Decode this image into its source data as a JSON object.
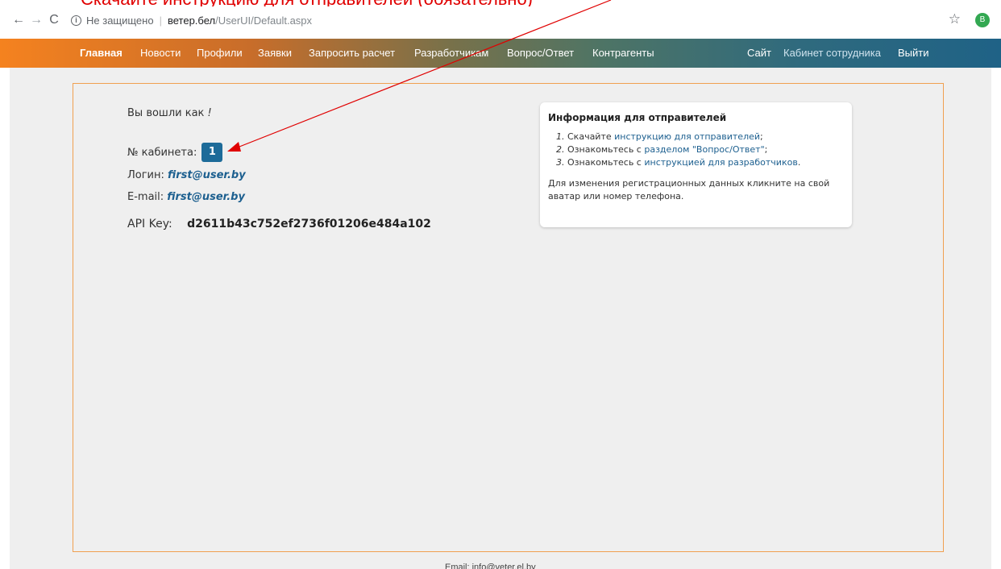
{
  "annotation": {
    "top_text": "Скачайте инструкцию для отправителей (обязательно)"
  },
  "browser": {
    "back_icon": "←",
    "forward_icon": "→",
    "reload_icon": "C",
    "info_icon": "i",
    "security_text": "Не защищено",
    "separator": "|",
    "domain": "ветер.бел",
    "path": "/UserUI/Default.aspx",
    "star_icon": "☆",
    "profile_letter": "B"
  },
  "nav": {
    "items": [
      {
        "label": "Главная"
      },
      {
        "label": "Новости"
      },
      {
        "label": "Профили"
      },
      {
        "label": "Заявки"
      },
      {
        "label": "Запросить расчет"
      },
      {
        "label": "Разработчикам"
      },
      {
        "label": "Вопрос/Ответ"
      },
      {
        "label": "Контрагенты"
      }
    ],
    "right": [
      {
        "label": "Сайт"
      },
      {
        "label": "Кабинет сотрудника"
      },
      {
        "label": "Выйти"
      }
    ],
    "gradient_start": "#f5821f",
    "gradient_end": "#1f6286"
  },
  "user": {
    "logged_in_label": "Вы вошли как",
    "logged_in_value": "!",
    "cabinet_label": "№ кабинета:",
    "cabinet_number": "1",
    "login_label": "Логин:",
    "login_value": "first@user.by",
    "email_label": "E-mail:",
    "email_value": "first@user.by",
    "api_label": "API Key:",
    "api_value": "d2611b43c752ef2736f01206e484a102",
    "badge_color": "#1d6b99"
  },
  "info": {
    "title": "Информация для отправителей",
    "items": [
      {
        "num": "1.",
        "pre": "Скачайте",
        "link": "инструкцию для отправителей",
        "post": ";"
      },
      {
        "num": "2.",
        "pre": "Ознакомьтесь с",
        "link": "разделом \"Вопрос/Ответ\"",
        "post": ";"
      },
      {
        "num": "3.",
        "pre": "Ознакомьтесь с",
        "link": "инструкцией для разработчиков",
        "post": "."
      }
    ],
    "note": "Для изменения регистрационных данных кликните на свой аватар или номер телефона."
  },
  "footer": {
    "text": "Email: info@veter.el.by"
  },
  "colors": {
    "frame_border": "#f0a050",
    "annotation": "#e00000",
    "link": "#1c5f8f"
  }
}
